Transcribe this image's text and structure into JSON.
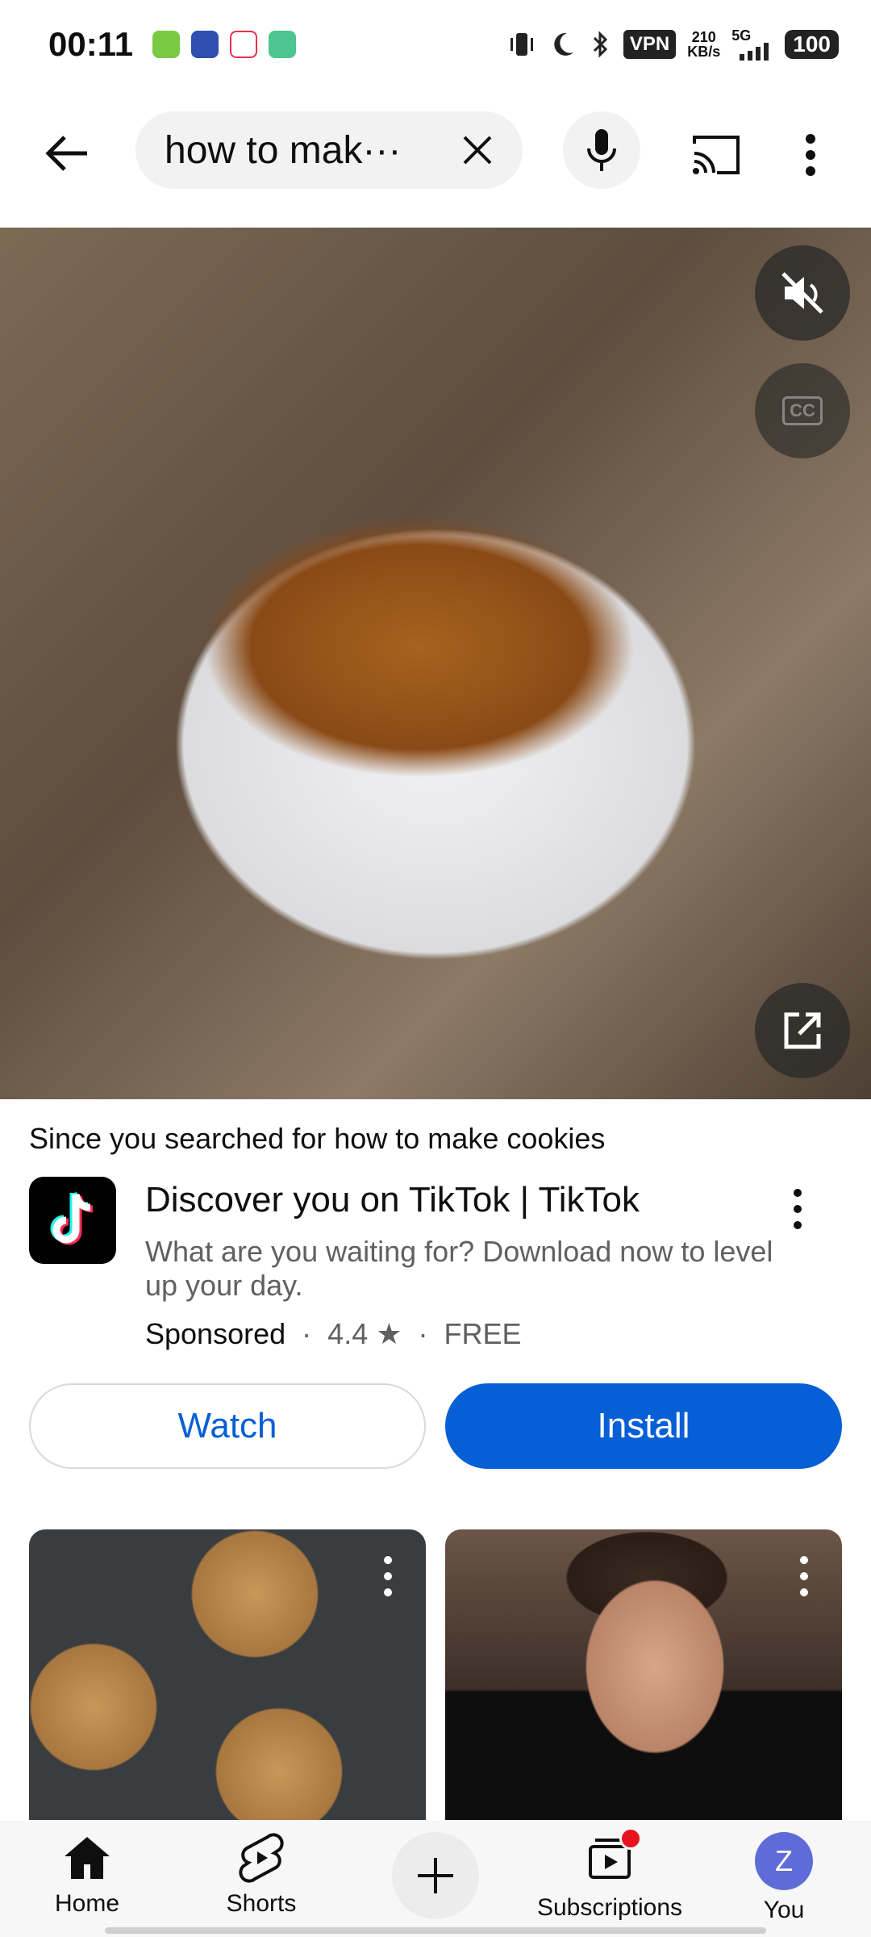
{
  "status_bar": {
    "time": "00:11",
    "vpn": "VPN",
    "speed_value": "210",
    "speed_unit": "KB/s",
    "network": "5G",
    "battery": "100",
    "notif_app_colors": [
      "#7ac943",
      "#2f4fb0",
      "#e8304a",
      "#4cc58f"
    ]
  },
  "search": {
    "query": "how to mak···",
    "back_icon": "arrow-left-icon",
    "clear_icon": "close-icon",
    "mic_icon": "microphone-icon",
    "cast_icon": "cast-icon",
    "more_icon": "more-vertical-icon"
  },
  "video": {
    "mute_icon": "muted-speaker-icon",
    "cc_label": "CC",
    "open_icon": "open-external-icon"
  },
  "ad": {
    "reason_prefix": "Since you searched for",
    "reason_query": "how to make cookies",
    "title": "Discover you on TikTok | TikTok",
    "description": "What are you waiting for? Download now to level up your day.",
    "sponsored": "Sponsored",
    "separator": "·",
    "rating": "4.4",
    "price": "FREE",
    "watch_label": "Watch",
    "install_label": "Install",
    "accent_color": "#065fd4"
  },
  "results": [
    {
      "thumbnail": "chocolate-chip-cookies-thumbnail"
    },
    {
      "thumbnail": "man-cooking-thumbnail"
    }
  ],
  "nav": {
    "home": "Home",
    "shorts": "Shorts",
    "subscriptions": "Subscriptions",
    "you": "You",
    "avatar_letter": "Z"
  }
}
